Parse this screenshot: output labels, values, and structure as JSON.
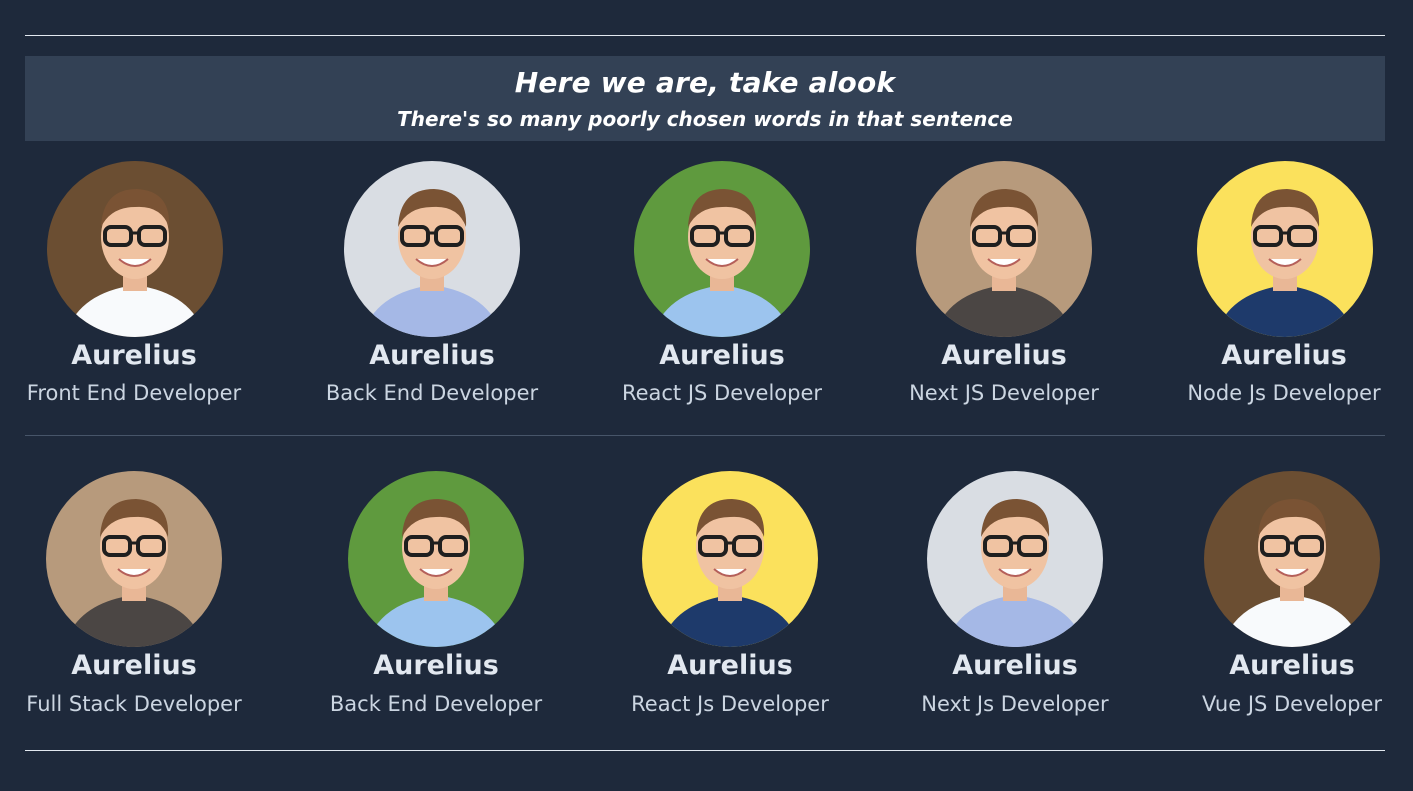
{
  "banner": {
    "title": "Here we are, take alook",
    "subtitle": "There's so many poorly chosen words in that sentence"
  },
  "team": [
    {
      "name": "Aurelius",
      "role": "Front End Developer",
      "photo": "person-photo-tree",
      "bg": "#6b4e32",
      "shirt": "#f8fafc"
    },
    {
      "name": "Aurelius",
      "role": "Back End Developer",
      "photo": "person-photo-light",
      "bg": "#d9dde3",
      "shirt": "#a5b8e6"
    },
    {
      "name": "Aurelius",
      "role": "React JS Developer",
      "photo": "person-photo-green",
      "bg": "#5f9a3e",
      "shirt": "#9cc4ee"
    },
    {
      "name": "Aurelius",
      "role": "Next JS Developer",
      "photo": "person-photo-hallway",
      "bg": "#b79a7c",
      "shirt": "#4b4644"
    },
    {
      "name": "Aurelius",
      "role": "Node Js Developer",
      "photo": "person-photo-yellow",
      "bg": "#fbe15c",
      "shirt": "#1e3a6b"
    },
    {
      "name": "Aurelius",
      "role": "Full Stack Developer",
      "photo": "person-photo-hallway",
      "bg": "#b79a7c",
      "shirt": "#4b4644"
    },
    {
      "name": "Aurelius",
      "role": "Back End Developer",
      "photo": "person-photo-green",
      "bg": "#5f9a3e",
      "shirt": "#9cc4ee"
    },
    {
      "name": "Aurelius",
      "role": "React Js Developer",
      "photo": "person-photo-yellow",
      "bg": "#fbe15c",
      "shirt": "#1e3a6b"
    },
    {
      "name": "Aurelius",
      "role": "Next Js Developer",
      "photo": "person-photo-light",
      "bg": "#d9dde3",
      "shirt": "#a5b8e6"
    },
    {
      "name": "Aurelius",
      "role": "Vue JS Developer",
      "photo": "person-photo-tree",
      "bg": "#6b4e32",
      "shirt": "#f8fafc"
    }
  ]
}
